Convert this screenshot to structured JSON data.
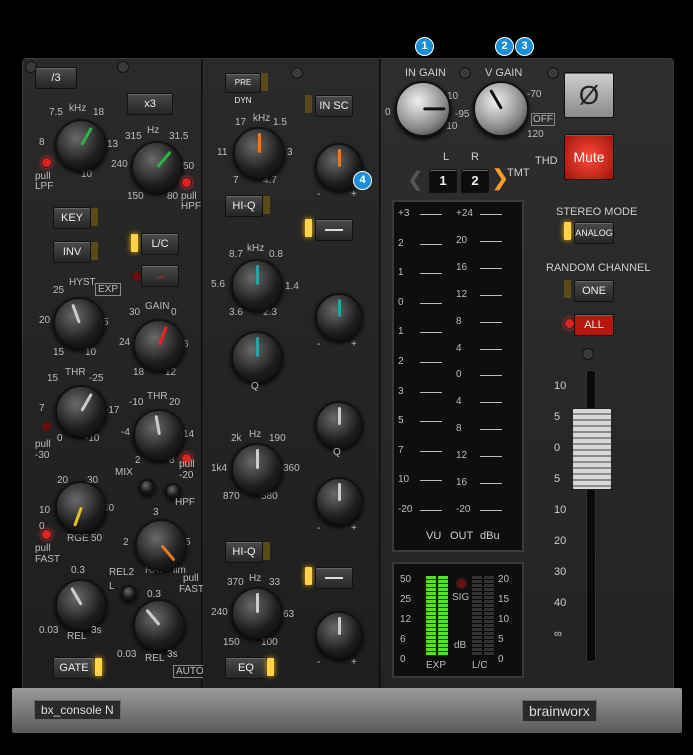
{
  "plugin": {
    "name_label": "bx_console N",
    "brand_label": "brainworx"
  },
  "callouts": {
    "c1": "1",
    "c2": "2",
    "c3": "3",
    "c4": "4"
  },
  "filters": {
    "btn_div3": "/3",
    "btn_x3": "x3",
    "lpf": {
      "l1": "7.5",
      "l2": "kHz",
      "l3": "18",
      "l4": "8",
      "l5": "13",
      "l6": "10",
      "l7": "pull",
      "l8": "LPF"
    },
    "hpf": {
      "l1": "315",
      "l2": "Hz",
      "l3": "31.5",
      "l4": "240",
      "l5": "50",
      "l6": "150",
      "l7": "80",
      "l8": "pull",
      "l9": "HPF"
    }
  },
  "dynamics": {
    "btn_key": "KEY",
    "btn_inv": "INV",
    "btn_lc": "L/C",
    "arrow": "→",
    "exp": "EXP",
    "hyst": {
      "l1": "25",
      "l2": "HYST",
      "l3": "20",
      "l4": "5",
      "l5": "15",
      "l6": "10"
    },
    "gain": {
      "l1": "30",
      "l2": "GAIN",
      "l3": "0",
      "l4": "24",
      "l5": "6",
      "l6": "18",
      "l7": "12"
    },
    "thr1": {
      "l1": "15",
      "l2": "THR",
      "l3": "-25",
      "l4": "7",
      "l5": "-17",
      "l6": "0",
      "l7": "-10",
      "l8": "pull",
      "l9": "-30"
    },
    "thr2": {
      "l1": "-10",
      "l2": "THR",
      "l3": "20",
      "l4": "-4",
      "l5": "14",
      "l6": "2",
      "l7": "8"
    },
    "mix": "MIX",
    "pull_minus20": "pull",
    "minus20": "-20",
    "hpf": "HPF",
    "rge": {
      "l1": "20",
      "l2": "30",
      "l3": "10",
      "l4": "40",
      "l5": "0",
      "l6": "RGE",
      "l7": "50",
      "l8": "pull",
      "l9": "FAST"
    },
    "rat": {
      "l1": "3",
      "l2": "2",
      "l3": "5",
      "l4": "RAT",
      "l5": "lim",
      "l6": "pull",
      "l7": "FAST"
    },
    "rel1": {
      "l1": "0.3",
      "l2": "0.03",
      "l3": "REL",
      "l4": "3s"
    },
    "rel2": {
      "l1": "REL2",
      "l2": "L",
      "l3": "0.3",
      "l4": "0.03",
      "l5": "REL",
      "l6": "3s",
      "l7": "AUTO"
    },
    "btn_gate": "GATE"
  },
  "eq": {
    "btn_predyn": "PRE DYN",
    "btn_insc": "IN SC",
    "btn_hiq1": "HI-Q",
    "btn_hiq2": "HI-Q",
    "btn_eq": "EQ",
    "b1": {
      "l1": "17",
      "l2": "kHz",
      "l3": "1.5",
      "l4": "11",
      "l5": "3",
      "l6": "7",
      "l7": "4.7"
    },
    "b2": {
      "l1": "8.7",
      "l2": "kHz",
      "l3": "0.8",
      "l4": "5.6",
      "l5": "1.4",
      "l6": "3.6",
      "l7": "2.3"
    },
    "q1": "Q",
    "b3": {
      "l1": "2k",
      "l2": "Hz",
      "l3": "190",
      "l4": "1k4",
      "l5": "360",
      "l6": "870",
      "l7": "580"
    },
    "q2": "Q",
    "b4": {
      "l1": "370",
      "l2": "Hz",
      "l3": "33",
      "l4": "240",
      "l5": "63",
      "l6": "150",
      "l7": "100"
    },
    "minus": "-",
    "plus": "+"
  },
  "io": {
    "in_gain": "IN GAIN",
    "v_gain": "V GAIN",
    "ing": {
      "l1": "0",
      "l2": "-10",
      "l3": "10"
    },
    "vg": {
      "l1": "-95",
      "l2": "-70",
      "l3": "120",
      "l4": "OFF"
    },
    "l": "L",
    "r": "R",
    "ch1": "1",
    "ch2": "2",
    "tmt": "TMT",
    "thd": "THD"
  },
  "meter": {
    "left_ticks": [
      "+3",
      "2",
      "1",
      "0",
      "1",
      "2",
      "3",
      "5",
      "7",
      "10",
      "-20"
    ],
    "right_ticks": [
      "+24",
      "20",
      "16",
      "12",
      "8",
      "4",
      "0",
      "4",
      "8",
      "12",
      "16",
      "-20"
    ],
    "vu": "VU",
    "out": "OUT",
    "dbu": "dBu"
  },
  "gr": {
    "left": [
      "50",
      "25",
      "12",
      "6",
      "0"
    ],
    "right": [
      "20",
      "15",
      "10",
      "5",
      "0"
    ],
    "sig": "SIG",
    "db": "dB",
    "exp": "EXP",
    "lc": "L/C"
  },
  "right": {
    "phase": "Ø",
    "mute": "Mute",
    "stereo_mode": "STEREO MODE",
    "analog": "ANALOG",
    "random_channel": "RANDOM CHANNEL",
    "one": "ONE",
    "all": "ALL",
    "fader": [
      "10",
      "5",
      "0",
      "5",
      "10",
      "20",
      "30",
      "40",
      "∞"
    ]
  }
}
